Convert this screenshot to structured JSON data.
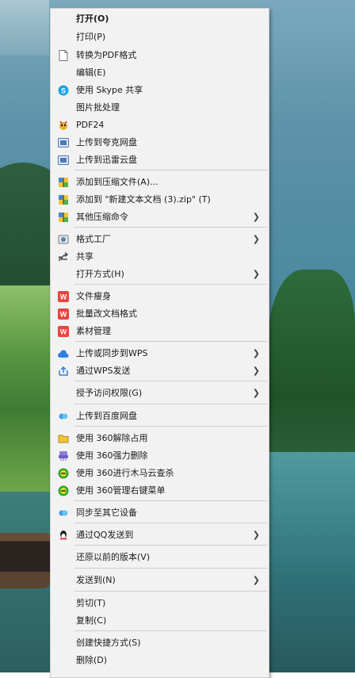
{
  "menu": {
    "items": [
      {
        "label": "打开(O)",
        "icon": "",
        "submenu": false,
        "bold": true
      },
      {
        "label": "打印(P)",
        "icon": "",
        "submenu": false
      },
      {
        "label": "转换为PDF格式",
        "icon": "document-icon",
        "submenu": false
      },
      {
        "label": "编辑(E)",
        "icon": "",
        "submenu": false
      },
      {
        "label": "使用 Skype 共享",
        "icon": "skype-icon",
        "submenu": false
      },
      {
        "label": "图片批处理",
        "icon": "",
        "submenu": false
      },
      {
        "label": "PDF24",
        "icon": "pdf24-icon",
        "submenu": false
      },
      {
        "label": "上传到夸克网盘",
        "icon": "cloud-drive-icon",
        "submenu": false
      },
      {
        "label": "上传到迅雷云盘",
        "icon": "cloud-drive-icon",
        "submenu": false
      },
      {
        "label": "添加到压缩文件(A)...",
        "icon": "archive-icon",
        "submenu": false
      },
      {
        "label": "添加到 \"新建文本文档 (3).zip\" (T)",
        "icon": "archive-icon",
        "submenu": false
      },
      {
        "label": "其他压缩命令",
        "icon": "archive-icon",
        "submenu": true
      },
      {
        "label": "格式工厂",
        "icon": "format-factory-icon",
        "submenu": true
      },
      {
        "label": "共享",
        "icon": "share-icon",
        "submenu": false
      },
      {
        "label": "打开方式(H)",
        "icon": "",
        "submenu": true
      },
      {
        "label": "文件瘦身",
        "icon": "wps-icon",
        "submenu": false
      },
      {
        "label": "批量改文档格式",
        "icon": "wps-icon",
        "submenu": false
      },
      {
        "label": "素材管理",
        "icon": "wps-icon",
        "submenu": false
      },
      {
        "label": "上传或同步到WPS",
        "icon": "wps-cloud-icon",
        "submenu": true
      },
      {
        "label": "通过WPS发送",
        "icon": "wps-send-icon",
        "submenu": true
      },
      {
        "label": "授予访问权限(G)",
        "icon": "",
        "submenu": true
      },
      {
        "label": "上传到百度网盘",
        "icon": "baidu-cloud-icon",
        "submenu": false
      },
      {
        "label": "使用 360解除占用",
        "icon": "folder-unlock-icon",
        "submenu": false
      },
      {
        "label": "使用 360强力删除",
        "icon": "shredder-icon",
        "submenu": false
      },
      {
        "label": "使用 360进行木马云查杀",
        "icon": "360-shield-icon",
        "submenu": false
      },
      {
        "label": "使用 360管理右键菜单",
        "icon": "360-shield-icon",
        "submenu": false
      },
      {
        "label": "同步至其它设备",
        "icon": "baidu-cloud-icon",
        "submenu": false
      },
      {
        "label": "通过QQ发送到",
        "icon": "qq-icon",
        "submenu": true
      },
      {
        "label": "还原以前的版本(V)",
        "icon": "",
        "submenu": false
      },
      {
        "label": "发送到(N)",
        "icon": "",
        "submenu": true
      },
      {
        "label": "剪切(T)",
        "icon": "",
        "submenu": false
      },
      {
        "label": "复制(C)",
        "icon": "",
        "submenu": false
      },
      {
        "label": "创建快捷方式(S)",
        "icon": "",
        "submenu": false
      },
      {
        "label": "删除(D)",
        "icon": "",
        "submenu": false
      }
    ]
  }
}
